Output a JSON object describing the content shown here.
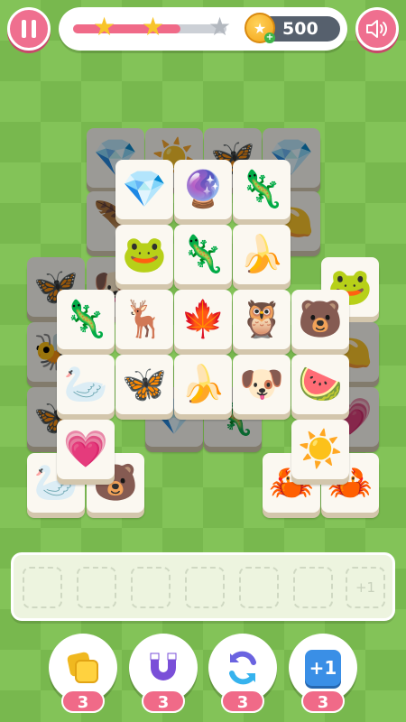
{
  "header": {
    "pause_icon": "pause-icon",
    "sound_icon": "speaker-icon",
    "progress_fraction": 0.7,
    "stars_earned": 2,
    "stars_total": 3,
    "coins": "500"
  },
  "board": {
    "tiles_top": [
      "gem",
      "rainbow-ball",
      "chameleon",
      "frog",
      "chameleon",
      "banana",
      "chameleon",
      "deer",
      "maple-leaf",
      "owl",
      "bear",
      "swan",
      "butterfly",
      "banana",
      "dog",
      "watermelon",
      "heart",
      "sun"
    ],
    "tiles_back": [
      "gem",
      "sun",
      "butterfly",
      "gem",
      "leaf",
      "lemon",
      "butterfly",
      "dog",
      "frog",
      "bee",
      "lemon",
      "butterfly",
      "heart",
      "swan",
      "bear",
      "crab",
      "crab"
    ]
  },
  "tray": {
    "slots": [
      "",
      "",
      "",
      "",
      "",
      "",
      ""
    ],
    "extra_slot_label": "+1"
  },
  "powerups": [
    {
      "name": "shuffle-tiles",
      "count": "3"
    },
    {
      "name": "magnet",
      "count": "3"
    },
    {
      "name": "undo-refresh",
      "count": "3"
    },
    {
      "name": "plus-one-slot",
      "label": "+1",
      "count": "3"
    }
  ],
  "colors": {
    "accent": "#f06a88",
    "board_light": "#83c358",
    "board_dark": "#78b84e",
    "coin": "#f3a316"
  }
}
